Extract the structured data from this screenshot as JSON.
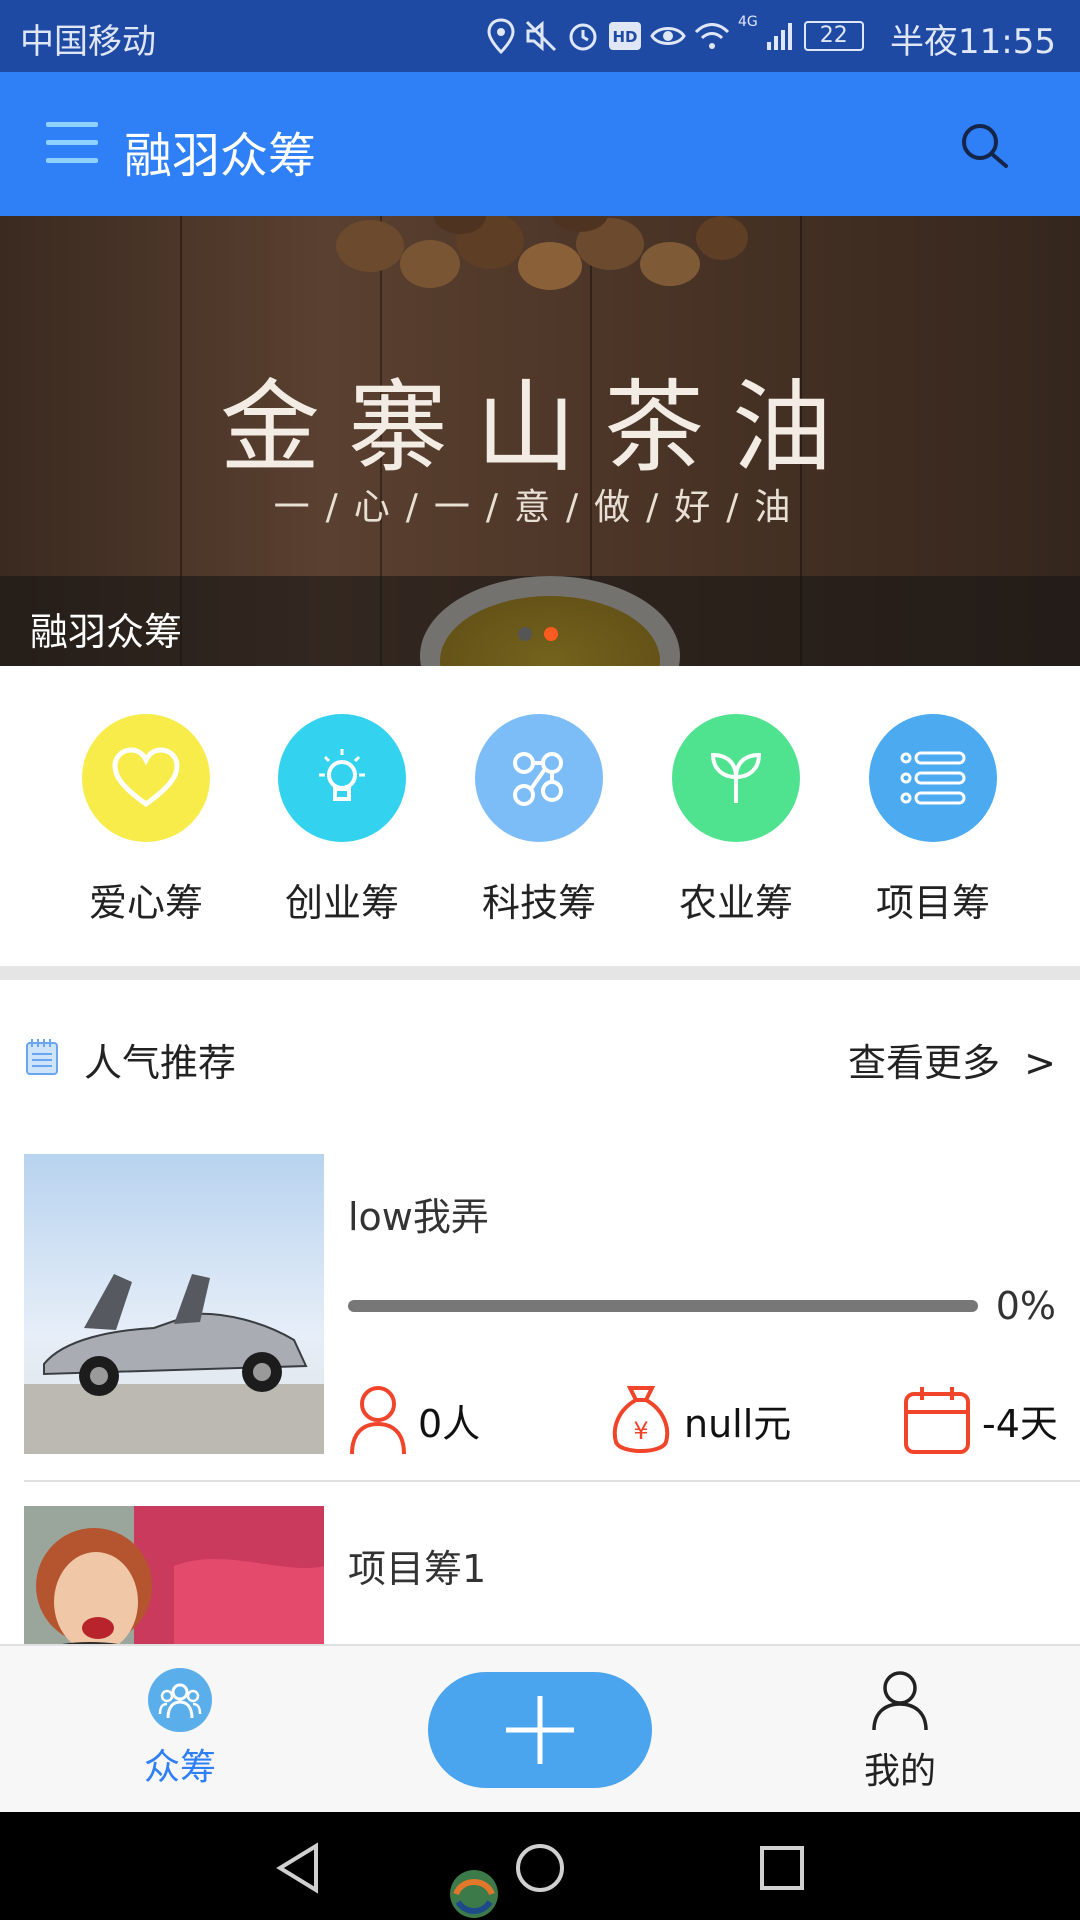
{
  "status_bar": {
    "carrier": "中国移动",
    "network": "4G",
    "battery": "22",
    "time": "半夜11:55",
    "icons": [
      "location-icon",
      "mute-icon",
      "alarm-icon",
      "hd-icon",
      "eye-icon",
      "wifi-icon",
      "signal-icon",
      "battery-icon"
    ]
  },
  "app_bar": {
    "title": "融羽众筹",
    "menu_icon": "menu-icon",
    "search_icon": "search-icon"
  },
  "banner": {
    "headline": "金寨山茶油",
    "tagline": "一/心/一/意/做/好/油",
    "caption": "融羽众筹",
    "slide_count": 2,
    "active_slide": 2,
    "colors": {
      "dot_active": "#ff5a1f",
      "dot_inactive": "#555555"
    }
  },
  "categories": [
    {
      "label": "爱心筹",
      "icon": "heart-icon",
      "color": "#f7ec4a"
    },
    {
      "label": "创业筹",
      "icon": "lightbulb-icon",
      "color": "#33d3f0"
    },
    {
      "label": "科技筹",
      "icon": "molecule-icon",
      "color": "#7dbdf7"
    },
    {
      "label": "农业筹",
      "icon": "sprout-icon",
      "color": "#4fe38f"
    },
    {
      "label": "项目筹",
      "icon": "list-icon",
      "color": "#4baaf0"
    }
  ],
  "popular": {
    "title": "人气推荐",
    "more": "查看更多",
    "more_arrow": ">",
    "items": [
      {
        "name": "low我弄",
        "percent": "0%",
        "progress": 0,
        "supporters": "0人",
        "amount": "null元",
        "days": "-4天",
        "image": "car-photo"
      },
      {
        "name": "项目筹1",
        "image": "woman-photo"
      }
    ]
  },
  "bottom_nav": {
    "home_label": "众筹",
    "me_label": "我的",
    "add_icon": "plus-icon",
    "colors": {
      "active": "#2f80f7",
      "add_button": "#4aa4ee"
    }
  },
  "colors": {
    "status_bar": "#1f4aa3",
    "app_bar": "#2f80f7",
    "accent_stat": "#f0452a"
  }
}
